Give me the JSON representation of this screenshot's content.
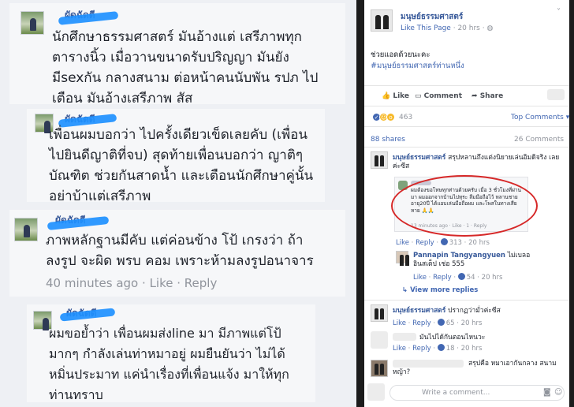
{
  "left": {
    "comments": [
      {
        "name": "ผัดฉัดดี",
        "text_lines": [
          "นักศึกษาธรรมศาสตร์ มันอ้างแต่ เสรีภาพทุก",
          "ตารางนิ้ว เมื่อวานขนาดรับปริญญา มันยัง",
          "มีsexกัน กลางสนาม ต่อหน้าคนนับพัน รปภ ไป",
          "เตือน มันอ้างเสรีภาพ สัส"
        ]
      },
      {
        "name": "ผัดฉัดดี",
        "text_lines": [
          "เพื่อนผมบอกว่า ไปครั้งเดียวเข็ดเลยคับ (เพื่อน",
          "ไปยินดีญาติที่จบ) สุดท้ายเพื่อนบอกว่า ญาติๆ",
          "บัณฑิต ช่วยกันสาดน้ำ และเตือนนักศึกษาคู่นั้น",
          "อย่าบ้าแต่เสรีภาพ"
        ]
      },
      {
        "name": "ผัดฉัดดี",
        "text_lines": [
          "ภาพหลักฐานมีคับ แต่ค่อนข้าง โป้ เกรงว่า ถ้า",
          "ลงรูป จะผิด พรบ คอม เพราะห้ามลงรูปอนาจาร"
        ],
        "time": "40 minutes ago",
        "like": "Like",
        "reply": "Reply"
      },
      {
        "name": "ผัดฉัดดี",
        "text_lines": [
          "ผมขอย้ำว่า เพื่อนผมส่งline มา มีภาพแต่โป้",
          "มากๆ กำลังเล่นท่าหมาอยู่ ผมยืนยันว่า ไม่ได้",
          "หมิ่นประมาท แค่นำเรื่องที่เพื่อนแจ้ง มาให้ทุก",
          "ท่านทราบ"
        ]
      }
    ]
  },
  "post": {
    "page_name": "มนุษย์ธรรมศาสตร์",
    "like_page": "Like This Page",
    "time": "20 hrs",
    "caption": "ช่วยแอดด้วยนะคะ",
    "hashtag": "#มนุษย์ธรรมศาสตร์ท่านหนึ่ง",
    "actions": {
      "like": "Like",
      "comment": "Comment",
      "share": "Share"
    },
    "reaction_count": "463",
    "top_comments": "Top Comments ▾",
    "shares": "88 shares",
    "comments_count": "26 Comments",
    "comments": [
      {
        "name": "มนุษย์ธรรมศาสตร์",
        "text": "สรุปหลานถึงแต่งนิยายเล่นอิมดิจริง เลยค่ะซีส",
        "nested_text": "ผมต้องขอโทษทุกท่านด้วยครับ เมื่อ 3 ชั่วโมงที่ผ่านมา ผมออกจากบ้านไปทุระ ลืมมือถือไว้ หลานชายอายุ20ปี ได้แอบเล่นมือถือผม และโพสในทางเสียหาย 🙏🙏",
        "nested_meta": "13 minutes ago · Like · 1 · Reply",
        "meta": {
          "like": "Like",
          "reply": "Reply",
          "count": "313",
          "time": "20 hrs"
        }
      },
      {
        "name": "Pannapin Tangyangyuen",
        "text": "ไม่เบลออินสเต็ป เช่อ 555",
        "meta": {
          "like": "Like",
          "reply": "Reply",
          "count": "54",
          "time": "20 hrs"
        }
      },
      {
        "view_more": "↳ View more replies"
      },
      {
        "name": "มนุษย์ธรรมศาสตร์",
        "text": "ปรากฏว่ามั่วค่ะซีส",
        "meta": {
          "like": "Like",
          "reply": "Reply",
          "count": "65",
          "time": "20 hrs"
        }
      },
      {
        "text": "มันไปได้กันตอนไหนวะ",
        "meta": {
          "like": "Like",
          "reply": "Reply",
          "count": "18",
          "time": "20 hrs"
        }
      },
      {
        "text": "สรุปคือ หมาเอากันกลาง สนามหญ้า?"
      }
    ],
    "write_comment": "Write a comment..."
  }
}
